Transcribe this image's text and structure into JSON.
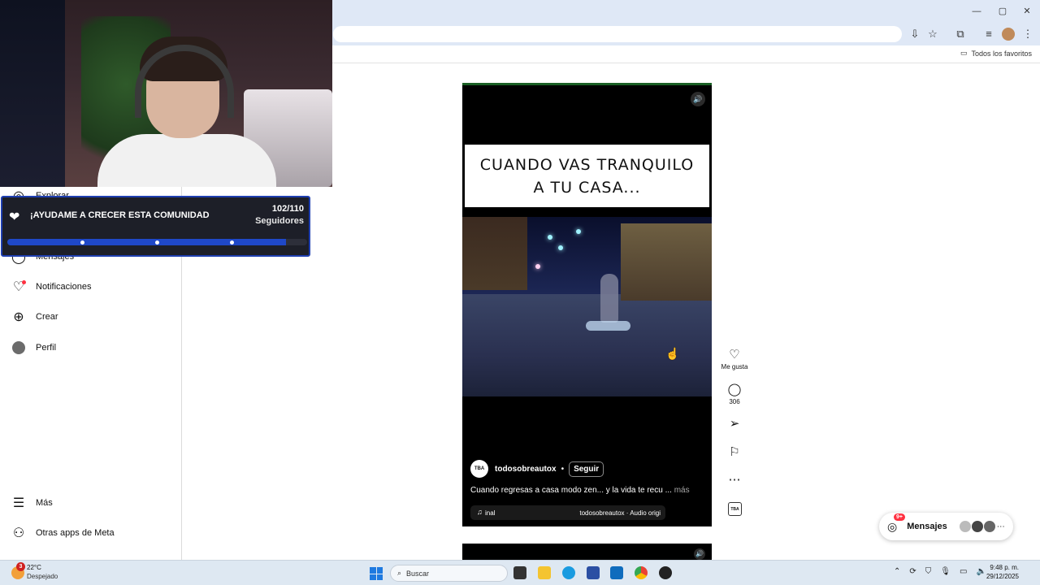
{
  "browser": {
    "bookmarks_all": "Todos los favoritos"
  },
  "sidebar": {
    "items": [
      {
        "label": "Explorar",
        "icon": "compass-icon"
      },
      {
        "label": "Mensajes",
        "icon": "messenger-icon"
      },
      {
        "label": "Notificaciones",
        "icon": "heart-icon"
      },
      {
        "label": "Crear",
        "icon": "plus-square-icon"
      },
      {
        "label": "Perfil",
        "icon": "avatar-icon"
      },
      {
        "label": "Más",
        "icon": "menu-icon"
      },
      {
        "label": "Otras apps de Meta",
        "icon": "meta-apps-icon"
      }
    ]
  },
  "goal_widget": {
    "title": "¡AYUDAME A CRECER ESTA COMUNIDAD",
    "count": "102/110",
    "subtitle": "Seguidores",
    "progress_fraction": 0.93,
    "accent": "#1f48c8"
  },
  "reel": {
    "caption": "CUANDO VAS TRANQUILO A TU CASA...",
    "author": "todosobreautox",
    "separator": "•",
    "follow_label": "Seguir",
    "avatar_text": "TBA",
    "description": "Cuando regresas a casa modo zen... y la vida te recu ...",
    "more_label": "más",
    "audio_left": "inal",
    "audio_right": "todosobreautox · Audio origi"
  },
  "actions": {
    "like_label": "Me gusta",
    "comments_count": "306"
  },
  "messages": {
    "label": "Mensajes",
    "badge": "9+"
  },
  "taskbar": {
    "weather_temp": "22°C",
    "weather_desc": "Despejado",
    "weather_badge": "3",
    "search_placeholder": "Buscar",
    "time": "9:48 p. m.",
    "date": "29/12/2025"
  },
  "colors": {
    "browser_chrome": "#dfe8f6",
    "taskbar": "#dee8f2",
    "badge_red": "#ff3040"
  }
}
